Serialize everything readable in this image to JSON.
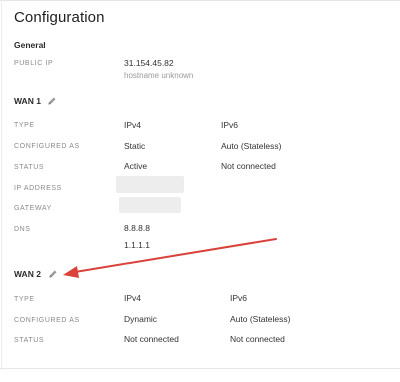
{
  "page": {
    "title": "Configuration"
  },
  "general": {
    "heading": "General",
    "public_ip_label": "PUBLIC IP",
    "public_ip_value": "31.154.45.82",
    "hostname_value": "hostname unknown"
  },
  "wan1": {
    "heading": "WAN 1",
    "edit_icon": "pencil-icon",
    "rows": {
      "type": {
        "label": "TYPE",
        "v4": "IPv4",
        "v6": "IPv6"
      },
      "configured_as": {
        "label": "CONFIGURED AS",
        "v4": "Static",
        "v6": "Auto (Stateless)"
      },
      "status": {
        "label": "STATUS",
        "v4": "Active",
        "v6": "Not connected"
      },
      "ip_address": {
        "label": "IP ADDRESS"
      },
      "gateway": {
        "label": "GATEWAY"
      },
      "dns": {
        "label": "DNS",
        "values": [
          "8.8.8.8",
          "1.1.1.1"
        ]
      }
    }
  },
  "wan2": {
    "heading": "WAN 2",
    "edit_icon": "pencil-icon",
    "rows": {
      "type": {
        "label": "TYPE",
        "v4": "IPv4",
        "v6": "IPv6"
      },
      "configured_as": {
        "label": "CONFIGURED AS",
        "v4": "Dynamic",
        "v6": "Auto (Stateless)"
      },
      "status": {
        "label": "STATUS",
        "v4": "Not connected",
        "v6": "Not connected"
      }
    }
  },
  "colors": {
    "annotation_arrow": "#d9423a",
    "text": "#333333",
    "label": "#8a8a8a"
  }
}
